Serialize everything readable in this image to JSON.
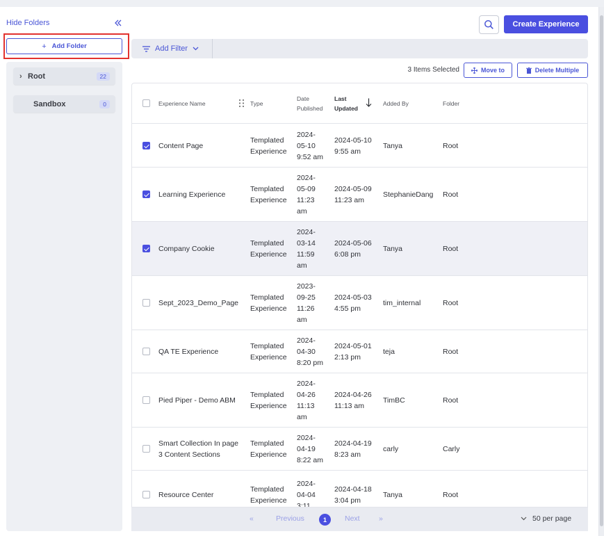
{
  "sidebar": {
    "hide_label": "Hide Folders",
    "add_folder_label": "Add Folder",
    "folders": [
      {
        "name": "Root",
        "count": "22"
      },
      {
        "name": "Sandbox",
        "count": "0"
      }
    ]
  },
  "header": {
    "create_label": "Create Experience",
    "add_filter_label": "Add Filter"
  },
  "selection": {
    "count_text": "3 Items Selected",
    "move_label": "Move to",
    "delete_label": "Delete Multiple"
  },
  "table": {
    "columns": {
      "name": "Experience Name",
      "type": "Type",
      "published": [
        "Date",
        "Published"
      ],
      "updated": [
        "Last",
        "Updated"
      ],
      "added_by": "Added By",
      "folder": "Folder"
    },
    "rows": [
      {
        "checked": true,
        "name": [
          "Content Page"
        ],
        "type": [
          "Templated",
          "Experience"
        ],
        "published": [
          "2024-",
          "05-10",
          "9:52 am"
        ],
        "updated": [
          "2024-05-10",
          "9:55 am"
        ],
        "added_by": "Tanya",
        "folder": "Root"
      },
      {
        "checked": true,
        "name": [
          "Learning Experience"
        ],
        "type": [
          "Templated",
          "Experience"
        ],
        "published": [
          "2024-",
          "05-09",
          "11:23",
          "am"
        ],
        "updated": [
          "2024-05-09",
          "11:23 am"
        ],
        "added_by": "StephanieDang",
        "folder": "Root"
      },
      {
        "checked": true,
        "name": [
          "Company Cookie"
        ],
        "type": [
          "Templated",
          "Experience"
        ],
        "published": [
          "2024-",
          "03-14",
          "11:59",
          "am"
        ],
        "updated": [
          "2024-05-06",
          "6:08 pm"
        ],
        "added_by": "Tanya",
        "folder": "Root"
      },
      {
        "checked": false,
        "name": [
          "Sept_2023_Demo_Page"
        ],
        "type": [
          "Templated",
          "Experience"
        ],
        "published": [
          "2023-",
          "09-25",
          "11:26",
          "am"
        ],
        "updated": [
          "2024-05-03",
          "4:55 pm"
        ],
        "added_by": "tim_internal",
        "folder": "Root"
      },
      {
        "checked": false,
        "name": [
          "QA TE Experience"
        ],
        "type": [
          "Templated",
          "Experience"
        ],
        "published": [
          "2024-",
          "04-30",
          "8:20 pm"
        ],
        "updated": [
          "2024-05-01",
          "2:13 pm"
        ],
        "added_by": "teja",
        "folder": "Root"
      },
      {
        "checked": false,
        "name": [
          "Pied Piper - Demo ABM"
        ],
        "type": [
          "Templated",
          "Experience"
        ],
        "published": [
          "2024-",
          "04-26",
          "11:13",
          "am"
        ],
        "updated": [
          "2024-04-26",
          "11:13 am"
        ],
        "added_by": "TimBC",
        "folder": "Root"
      },
      {
        "checked": false,
        "name": [
          "Smart Collection In page",
          "3 Content Sections"
        ],
        "type": [
          "Templated",
          "Experience"
        ],
        "published": [
          "2024-",
          "04-19",
          "8:22 am"
        ],
        "updated": [
          "2024-04-19",
          "8:23 am"
        ],
        "added_by": "carly",
        "folder": "Carly"
      },
      {
        "checked": false,
        "name": [
          "Resource Center"
        ],
        "type": [
          "Templated",
          "Experience"
        ],
        "published": [
          "2024-",
          "04-04",
          "3:11"
        ],
        "updated": [
          "2024-04-18",
          "3:04 pm"
        ],
        "added_by": "Tanya",
        "folder": "Root"
      }
    ]
  },
  "pagination": {
    "previous_label": "Previous",
    "current_page": "1",
    "next_label": "Next",
    "per_page_label": "50 per page"
  },
  "colors": {
    "accent": "#4a4fe0",
    "highlight_box": "#e3322e"
  }
}
